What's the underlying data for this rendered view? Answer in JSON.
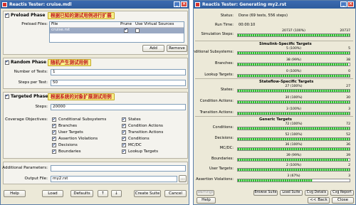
{
  "left_window": {
    "title": "Reactis Tester: cruise.mdl",
    "preload": {
      "title": "Preload Phase",
      "enabled": "✔",
      "callout": "根据已知的测试用例进行扩展",
      "files_label": "Preload Files:",
      "columns": [
        "File",
        "Prune",
        "Use Virtual Sources"
      ],
      "rows": [
        {
          "file": "cruise.rst",
          "prune": "✔",
          "virtual": ""
        }
      ],
      "add_label": "Add",
      "remove_label": "Remove"
    },
    "random": {
      "title": "Random Phase",
      "enabled": "✔",
      "callout": "随机产生测试用例",
      "tests_label": "Number of Tests:",
      "tests_value": "1",
      "steps_label": "Steps per Test:",
      "steps_value": "50"
    },
    "targeted": {
      "title": "Targeted Phase",
      "enabled": "✔",
      "callout": "根据系统的对象扩展测试用例",
      "steps_label": "Steps:",
      "steps_value": "20000",
      "objectives_label": "Coverage Objectives:",
      "objectives": [
        {
          "label": "Conditional Subsystems",
          "checked": "✔"
        },
        {
          "label": "States",
          "checked": "✔"
        },
        {
          "label": "Branches",
          "checked": "✔"
        },
        {
          "label": "Condition Actions",
          "checked": "✔"
        },
        {
          "label": "User Targets",
          "checked": "✔"
        },
        {
          "label": "Transition Actions",
          "checked": "✔"
        },
        {
          "label": "Assertion Violations",
          "checked": "✔"
        },
        {
          "label": "Conditions",
          "checked": "✔"
        },
        {
          "label": "Decisions",
          "checked": "✔"
        },
        {
          "label": "MC/DC",
          "checked": "✔"
        },
        {
          "label": "Boundaries",
          "checked": "✔"
        },
        {
          "label": "Lookup Targets",
          "checked": "✔"
        }
      ]
    },
    "additional_label": "Additional Parameters:",
    "additional_value": "",
    "output_label": "Output File:",
    "output_value": "my2.rst",
    "browse_label": "...",
    "buttons": {
      "help": "Help",
      "load": "Load",
      "defaults": "Defaults",
      "up": "↑",
      "down": "↓",
      "create": "Create Suite",
      "cancel": "Cancel"
    }
  },
  "right_window": {
    "title": "Reactis Tester: Generating my2.rst",
    "status_label": "Status:",
    "status_value": "Done (69 tests, 556 steps)",
    "runtime_label": "Run Time:",
    "runtime_value": "00:00:10",
    "sim_label": "Simulation Steps:",
    "sim": {
      "left": "",
      "mid": "20737 (100%)",
      "right": "20737",
      "fraction": 1.0
    },
    "groups": [
      {
        "title": "Simulink-Specific Targets",
        "items": [
          {
            "label": "Conditional Subsystems:",
            "mid": "5 (100%)",
            "right": "5",
            "fraction": 1.0
          },
          {
            "label": "Branches:",
            "mid": "38 (99%)",
            "right": "38",
            "fraction": 0.99
          },
          {
            "label": "Lookup Targets:",
            "mid": "0 (100%)",
            "right": "0",
            "fraction": 1.0
          }
        ]
      },
      {
        "title": "Stateflow-Specific Targets",
        "items": [
          {
            "label": "States:",
            "mid": "27 (100%)",
            "right": "27",
            "fraction": 1.0
          },
          {
            "label": "Condition Actions:",
            "mid": "30 (100%)",
            "right": "30",
            "fraction": 1.0
          },
          {
            "label": "Transition Actions:",
            "mid": "3 (100%)",
            "right": "3",
            "fraction": 1.0
          }
        ]
      },
      {
        "title": "Generic Targets",
        "items": [
          {
            "label": "Conditions:",
            "mid": "72 (100%)",
            "right": "72",
            "fraction": 1.0
          },
          {
            "label": "Decisions:",
            "mid": "52 (100%)",
            "right": "52",
            "fraction": 1.0
          },
          {
            "label": "MC/DC:",
            "mid": "36 (100%)",
            "right": "36",
            "fraction": 1.0
          },
          {
            "label": "Boundaries:",
            "mid": "39 (99%)",
            "right": "39",
            "fraction": 0.99
          },
          {
            "label": "User Targets:",
            "mid": "2 (100%)",
            "right": "2",
            "fraction": 1.0
          },
          {
            "label": "Assertion Violations:",
            "mid": "3 (67%)",
            "right": "3",
            "fraction": 0.67
          }
        ]
      }
    ],
    "buttons": {
      "warnings": "Warnings",
      "browse": "Browse Suite",
      "load": "Load Suite",
      "cvg_details": "Cvg Details",
      "cvg_report": "Cvg Report",
      "help": "Help",
      "back": "<< Back",
      "close": "Close"
    }
  }
}
